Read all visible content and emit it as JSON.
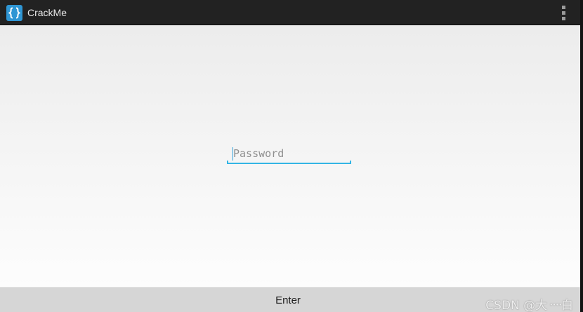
{
  "app": {
    "title": "CrackMe",
    "icon": "curly-braces-app-icon",
    "accent_color": "#33b5e5",
    "action_bar_color": "#222222"
  },
  "action_bar": {
    "overflow_icon": "vertical-ellipsis-icon"
  },
  "form": {
    "password_field": {
      "value": "",
      "placeholder": "Password"
    },
    "enter_button_label": "Enter"
  },
  "watermark": {
    "text": "CSDN @大᠁白"
  }
}
